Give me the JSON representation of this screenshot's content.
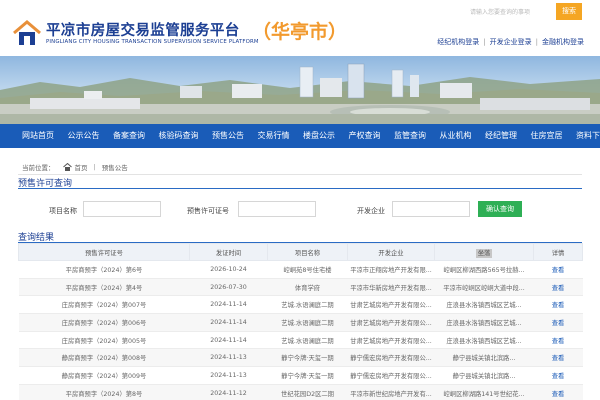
{
  "header": {
    "title": "平凉市房屋交易监管服务平台",
    "subtitle": "PINGLIANG CITY HOUSING TRANSACTION SUPERVISION SERVICE PLATFORM",
    "city": "（华亭市）",
    "search_placeholder": "请输入您要查询的事项",
    "search_label": "搜索",
    "login_links": [
      "经纪机构登录",
      "开发企业登录",
      "金融机构登录"
    ],
    "colors": {
      "brand": "#1c3f93",
      "accent": "#f29a2e",
      "nav": "#1a5cb8",
      "button": "#2eaf55"
    }
  },
  "nav": {
    "items": [
      "网站首页",
      "公示公告",
      "备案查询",
      "核验码查询",
      "预售公告",
      "交易行情",
      "楼盘公示",
      "产权查询",
      "监管查询",
      "从业机构",
      "经纪管理",
      "住房宜居",
      "资料下载"
    ]
  },
  "breadcrumb": {
    "current_label": "当前位置：",
    "home": "首页",
    "current": "预售公告"
  },
  "search_section": {
    "title": "预售许可查询",
    "fields": {
      "project_label": "项目名称",
      "permit_label": "预售许可证号",
      "company_label": "开发企业",
      "project_value": "",
      "permit_value": "",
      "company_value": ""
    },
    "submit_label": "确认查询"
  },
  "results": {
    "title": "查询结果",
    "columns": [
      "预售许可证号",
      "发证时间",
      "项目名称",
      "开发企业",
      "坐落",
      "详情"
    ],
    "rows": [
      [
        "平房商预字（2024）第6号",
        "2026-10-24",
        "崆峒苑8号住宅楼",
        "平凉市正翔房地产开发有限...",
        "崆峒区柳湖西路565号拉赫...",
        "查看"
      ],
      [
        "平房商预字（2024）第4号",
        "2026-07-30",
        "体育学府",
        "平凉市华新房地产开发有限...",
        "平凉市崆峒区崆峒大道中段...",
        "查看"
      ],
      [
        "庄房商预字（2024）第007号",
        "2024-11-14",
        "艺城.水语澜庭二期",
        "甘肃艺城房地产开发有限公...",
        "庄浪县水洛镇西城区艺城...",
        "查看"
      ],
      [
        "庄房商预字（2024）第006号",
        "2024-11-14",
        "艺城.水语澜庭二期",
        "甘肃艺城房地产开发有限公...",
        "庄浪县水洛镇西城区艺城...",
        "查看"
      ],
      [
        "庄房商预字（2024）第005号",
        "2024-11-14",
        "艺城.水语澜庭二期",
        "甘肃艺城房地产开发有限公...",
        "庄浪县水洛镇西城区艺城...",
        "查看"
      ],
      [
        "静房商预字（2024）第008号",
        "2024-11-13",
        "静宁今牌·天玺一期",
        "静宁儒宏房地产开发有限公...",
        "静宁县城关镇北滨路...",
        "查看"
      ],
      [
        "静房商预字（2024）第009号",
        "2024-11-13",
        "静宁今牌·天玺一期",
        "静宁儒宏房地产开发有限公...",
        "静宁县城关镇北滨路...",
        "查看"
      ],
      [
        "平房商预字（2024）第8号",
        "2024-11-12",
        "世纪花园D2区二期",
        "平凉市新世纪房地产开发有...",
        "崆峒区柳湖路141号世纪花...",
        "查看"
      ]
    ]
  }
}
